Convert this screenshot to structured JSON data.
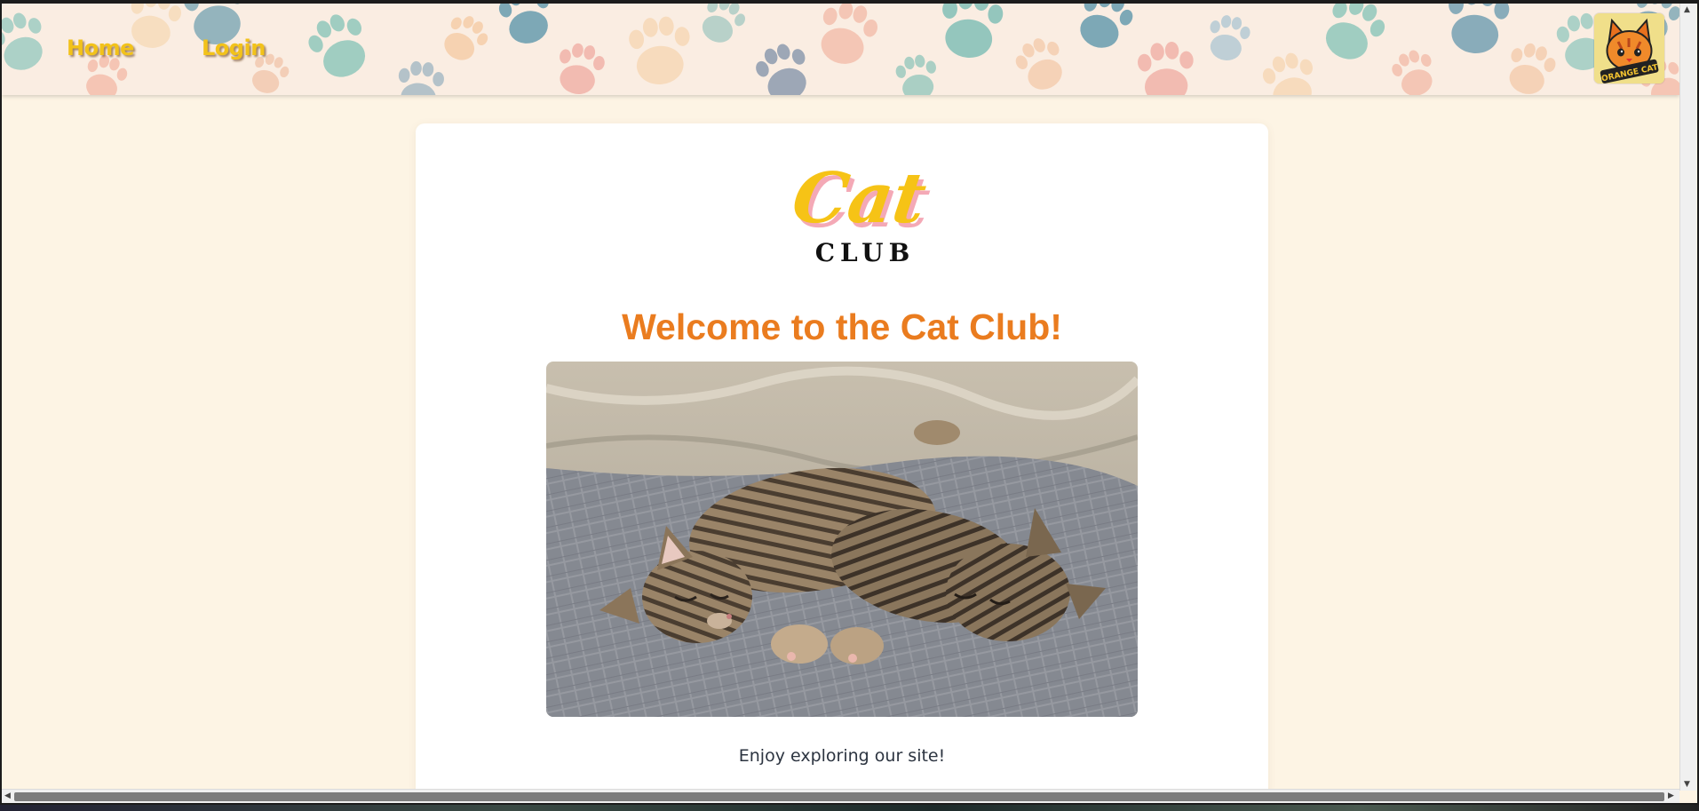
{
  "nav": {
    "home_label": "Home",
    "login_label": "Login"
  },
  "profile": {
    "icon": "orange-cat-avatar-icon",
    "badge_text": "ORANGE CAT"
  },
  "logo": {
    "line1": "Cat",
    "line2": "CLUB"
  },
  "main": {
    "heading": "Welcome to the Cat Club!",
    "image_subject": "two tabby kittens sleeping on a gray blanket",
    "tagline": "Enjoy exploring our site!"
  },
  "colors": {
    "page_bg": "#fdf4e4",
    "heading": "#ea7c1f",
    "nav_text": "#f2c21a",
    "logo_yellow": "#f6c316",
    "logo_pink": "#f4a9b6"
  }
}
